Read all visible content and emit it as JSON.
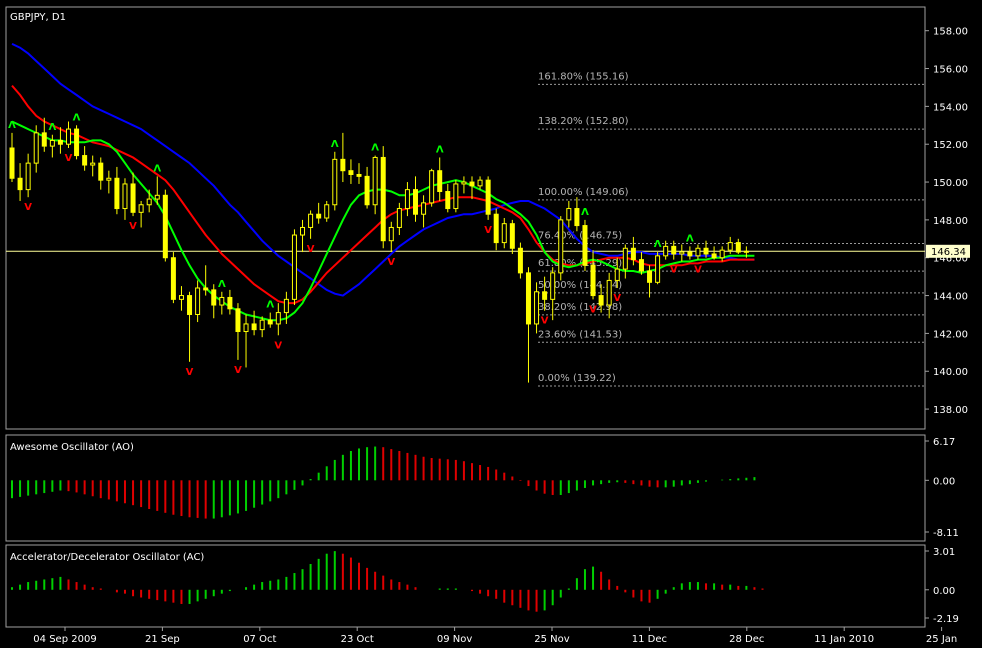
{
  "chart_data": {
    "type": "candlestick",
    "title": "GBPJPY, D1",
    "price_axis": {
      "ticks": [
        "158.00",
        "156.00",
        "154.00",
        "152.00",
        "150.00",
        "148.00",
        "146.00",
        "144.00",
        "142.00",
        "140.00",
        "138.00"
      ],
      "range": [
        137.0,
        159.2
      ]
    },
    "current_price": {
      "label": "146.34",
      "value": 146.34
    },
    "x_axis_labels": [
      "04 Sep 2009",
      "21 Sep",
      "07 Oct",
      "23 Oct",
      "09 Nov",
      "25 Nov",
      "11 Dec",
      "28 Dec",
      "11 Jan 2010",
      "25 Jan"
    ],
    "fibonacci": [
      {
        "label": "161.80% (155.16)",
        "value": 155.16
      },
      {
        "label": "138.20% (152.80)",
        "value": 152.8
      },
      {
        "label": "100.00% (149.06)",
        "value": 149.06
      },
      {
        "label": "76.40% (146.75)",
        "value": 146.75
      },
      {
        "label": "61.80% (145.29)",
        "value": 145.29
      },
      {
        "label": "50.00% (144.14)",
        "value": 144.14
      },
      {
        "label": "38.20% (142.98)",
        "value": 142.98
      },
      {
        "label": "23.60% (141.53)",
        "value": 141.53
      },
      {
        "label": "0.00% (139.22)",
        "value": 139.22
      }
    ],
    "candles": [
      [
        151.8,
        152.6,
        150.0,
        150.2
      ],
      [
        150.2,
        151.0,
        149.0,
        149.6
      ],
      [
        149.6,
        151.5,
        149.2,
        151.0
      ],
      [
        151.0,
        153.0,
        150.5,
        152.6
      ],
      [
        152.6,
        153.4,
        151.6,
        151.9
      ],
      [
        151.9,
        152.5,
        151.3,
        152.2
      ],
      [
        152.2,
        152.9,
        151.5,
        152.0
      ],
      [
        152.0,
        153.2,
        151.8,
        152.8
      ],
      [
        152.8,
        153.0,
        151.2,
        151.4
      ],
      [
        151.4,
        151.9,
        150.6,
        150.9
      ],
      [
        150.9,
        151.4,
        150.3,
        151.0
      ],
      [
        151.0,
        151.3,
        149.6,
        150.1
      ],
      [
        150.1,
        150.6,
        149.4,
        150.2
      ],
      [
        150.2,
        150.8,
        148.3,
        148.6
      ],
      [
        148.6,
        150.2,
        148.0,
        149.9
      ],
      [
        149.9,
        150.5,
        148.2,
        148.4
      ],
      [
        148.4,
        149.0,
        147.6,
        148.8
      ],
      [
        148.8,
        149.6,
        148.4,
        149.1
      ],
      [
        149.1,
        150.3,
        148.8,
        149.3
      ],
      [
        149.3,
        149.6,
        145.8,
        146.0
      ],
      [
        146.0,
        146.3,
        143.6,
        143.8
      ],
      [
        143.8,
        144.5,
        143.2,
        144.0
      ],
      [
        144.0,
        144.2,
        140.5,
        143.0
      ],
      [
        143.0,
        144.8,
        142.6,
        144.4
      ],
      [
        144.4,
        145.6,
        144.0,
        144.3
      ],
      [
        144.3,
        144.6,
        142.8,
        143.5
      ],
      [
        143.5,
        144.2,
        143.0,
        143.9
      ],
      [
        143.9,
        144.3,
        143.0,
        143.3
      ],
      [
        143.3,
        143.6,
        140.6,
        142.1
      ],
      [
        142.1,
        143.0,
        140.2,
        142.5
      ],
      [
        142.5,
        143.2,
        141.9,
        142.2
      ],
      [
        142.2,
        142.9,
        141.8,
        142.7
      ],
      [
        142.7,
        143.1,
        142.3,
        142.5
      ],
      [
        142.5,
        143.6,
        141.9,
        143.1
      ],
      [
        143.1,
        144.2,
        142.5,
        143.8
      ],
      [
        143.8,
        147.5,
        143.5,
        147.2
      ],
      [
        147.2,
        148.0,
        146.3,
        147.6
      ],
      [
        147.6,
        148.5,
        147.0,
        148.3
      ],
      [
        148.3,
        148.9,
        147.8,
        148.1
      ],
      [
        148.1,
        149.0,
        147.9,
        148.8
      ],
      [
        148.8,
        151.6,
        148.5,
        151.2
      ],
      [
        151.2,
        152.6,
        150.0,
        150.6
      ],
      [
        150.6,
        151.2,
        149.9,
        150.4
      ],
      [
        150.4,
        151.0,
        149.9,
        150.3
      ],
      [
        150.3,
        150.8,
        148.6,
        148.8
      ],
      [
        148.8,
        151.4,
        148.3,
        151.3
      ],
      [
        151.3,
        151.9,
        146.5,
        146.9
      ],
      [
        146.9,
        147.9,
        146.3,
        147.6
      ],
      [
        147.6,
        148.9,
        147.2,
        148.6
      ],
      [
        148.6,
        150.0,
        148.2,
        149.6
      ],
      [
        149.6,
        150.3,
        147.9,
        148.3
      ],
      [
        148.3,
        149.3,
        147.6,
        148.9
      ],
      [
        148.9,
        150.7,
        148.7,
        150.6
      ],
      [
        150.6,
        151.3,
        149.0,
        149.5
      ],
      [
        149.5,
        149.9,
        148.4,
        148.6
      ],
      [
        148.6,
        150.1,
        148.4,
        149.9
      ],
      [
        149.9,
        150.3,
        149.4,
        150.0
      ],
      [
        150.0,
        150.3,
        149.1,
        149.8
      ],
      [
        149.8,
        150.3,
        149.6,
        150.1
      ],
      [
        150.1,
        150.3,
        148.0,
        148.3
      ],
      [
        148.3,
        148.6,
        146.4,
        146.8
      ],
      [
        146.8,
        148.1,
        146.5,
        147.8
      ],
      [
        147.8,
        148.0,
        146.2,
        146.5
      ],
      [
        146.5,
        146.8,
        144.9,
        145.2
      ],
      [
        145.2,
        145.5,
        139.4,
        142.5
      ],
      [
        142.5,
        144.7,
        142.0,
        144.2
      ],
      [
        144.2,
        145.0,
        143.2,
        143.8
      ],
      [
        143.8,
        145.5,
        142.7,
        145.2
      ],
      [
        145.2,
        148.2,
        144.8,
        148.0
      ],
      [
        148.0,
        149.0,
        147.6,
        148.6
      ],
      [
        148.6,
        149.2,
        147.4,
        147.7
      ],
      [
        147.7,
        148.0,
        145.3,
        145.6
      ],
      [
        145.6,
        146.4,
        143.8,
        144.0
      ],
      [
        144.0,
        144.6,
        143.1,
        143.5
      ],
      [
        143.5,
        145.2,
        142.8,
        144.8
      ],
      [
        144.8,
        146.0,
        144.4,
        145.4
      ],
      [
        145.4,
        146.7,
        144.9,
        146.5
      ],
      [
        146.5,
        147.1,
        145.6,
        145.9
      ],
      [
        145.9,
        146.3,
        145.1,
        145.3
      ],
      [
        145.3,
        145.6,
        143.9,
        144.7
      ],
      [
        144.7,
        146.3,
        144.6,
        146.1
      ],
      [
        146.1,
        146.9,
        145.9,
        146.6
      ],
      [
        146.6,
        146.9,
        145.9,
        146.2
      ],
      [
        146.2,
        146.7,
        145.8,
        146.3
      ],
      [
        146.3,
        146.6,
        145.9,
        146.1
      ],
      [
        146.1,
        146.7,
        145.9,
        146.5
      ],
      [
        146.5,
        146.9,
        146.0,
        146.2
      ],
      [
        146.2,
        146.6,
        145.9,
        146.0
      ],
      [
        146.0,
        146.6,
        145.8,
        146.4
      ],
      [
        146.4,
        147.1,
        146.2,
        146.8
      ],
      [
        146.8,
        147.0,
        146.2,
        146.3
      ],
      [
        146.3,
        146.6,
        146.0,
        146.34
      ]
    ],
    "ma_blue": [
      157.3,
      157.1,
      156.8,
      156.4,
      156.0,
      155.6,
      155.2,
      154.9,
      154.6,
      154.3,
      154.0,
      153.8,
      153.6,
      153.4,
      153.2,
      153.0,
      152.8,
      152.5,
      152.2,
      151.9,
      151.6,
      151.3,
      151.0,
      150.6,
      150.2,
      149.8,
      149.3,
      148.8,
      148.4,
      147.9,
      147.4,
      146.9,
      146.5,
      146.1,
      145.8,
      145.5,
      145.2,
      144.9,
      144.6,
      144.3,
      144.1,
      144.0,
      144.3,
      144.6,
      145.0,
      145.4,
      145.8,
      146.2,
      146.6,
      146.9,
      147.2,
      147.5,
      147.7,
      147.9,
      148.1,
      148.2,
      148.3,
      148.3,
      148.4,
      148.5,
      148.6,
      148.8,
      148.9,
      149.0,
      149.0,
      148.8,
      148.6,
      148.3,
      148.0,
      147.5,
      147.0,
      146.6,
      146.3,
      146.2,
      146.1,
      146.1,
      146.2,
      146.3,
      146.3,
      146.2,
      146.2,
      146.2,
      146.2,
      146.2,
      146.1,
      146.1,
      146.1,
      146.1,
      146.0,
      146.0,
      145.9,
      145.9,
      145.9
    ],
    "ma_red": [
      155.1,
      154.6,
      154.0,
      153.5,
      153.2,
      153.0,
      152.8,
      152.6,
      152.5,
      152.3,
      152.1,
      152.0,
      151.9,
      151.7,
      151.5,
      151.3,
      151.0,
      150.7,
      150.4,
      150.1,
      149.6,
      149.0,
      148.4,
      147.8,
      147.2,
      146.7,
      146.2,
      145.8,
      145.4,
      145.0,
      144.6,
      144.3,
      144.0,
      143.7,
      143.6,
      143.6,
      143.8,
      144.2,
      144.7,
      145.2,
      145.6,
      146.0,
      146.4,
      146.8,
      147.2,
      147.6,
      148.0,
      148.3,
      148.5,
      148.6,
      148.7,
      148.8,
      148.9,
      149.0,
      149.1,
      149.2,
      149.2,
      149.2,
      149.1,
      149.0,
      148.8,
      148.6,
      148.4,
      148.1,
      147.5,
      146.8,
      146.3,
      145.9,
      145.7,
      145.6,
      145.6,
      145.7,
      145.8,
      145.9,
      146.0,
      146.0,
      146.0,
      145.9,
      145.7,
      145.6,
      145.6,
      145.6,
      145.6,
      145.6,
      145.7,
      145.7,
      145.8,
      145.8,
      145.8,
      145.9,
      145.9,
      145.9,
      145.9
    ],
    "ma_green": [
      153.2,
      153.0,
      152.8,
      152.6,
      152.4,
      152.2,
      152.2,
      152.1,
      152.1,
      152.1,
      152.2,
      152.2,
      152.0,
      151.6,
      151.0,
      150.4,
      149.9,
      149.4,
      148.9,
      148.2,
      147.3,
      146.4,
      145.6,
      144.9,
      144.4,
      144.0,
      143.7,
      143.4,
      143.2,
      143.0,
      142.9,
      142.8,
      142.7,
      142.7,
      142.8,
      143.1,
      143.6,
      144.4,
      145.3,
      146.2,
      147.1,
      148.0,
      148.8,
      149.3,
      149.5,
      149.6,
      149.6,
      149.5,
      149.3,
      149.3,
      149.4,
      149.6,
      149.8,
      149.9,
      150.0,
      150.1,
      150.0,
      149.8,
      149.6,
      149.4,
      149.1,
      148.9,
      148.6,
      148.3,
      147.9,
      147.2,
      146.3,
      145.8,
      145.6,
      145.5,
      145.6,
      145.8,
      145.9,
      145.8,
      145.6,
      145.4,
      145.3,
      145.3,
      145.2,
      145.3,
      145.4,
      145.6,
      145.7,
      145.8,
      145.8,
      145.9,
      145.9,
      146.0,
      146.0,
      146.1,
      146.1,
      146.1,
      146.1
    ],
    "fractals_up": [
      0,
      5,
      8,
      18,
      26,
      32,
      40,
      45,
      53,
      71,
      80,
      84
    ],
    "fractals_down": [
      2,
      7,
      15,
      22,
      28,
      33,
      37,
      47,
      59,
      66,
      72,
      75,
      82,
      85
    ],
    "ao": {
      "title": "Awesome Oscillator (AO)",
      "ticks": [
        "6.17",
        "0.00",
        "-8.11"
      ],
      "range": [
        -8.11,
        6.17
      ],
      "values": [
        -2.8,
        -2.6,
        -2.4,
        -2.2,
        -2.0,
        -1.8,
        -1.6,
        -1.7,
        -1.9,
        -2.2,
        -2.5,
        -2.8,
        -3.0,
        -3.3,
        -3.6,
        -3.9,
        -4.2,
        -4.5,
        -4.8,
        -5.1,
        -5.4,
        -5.6,
        -5.8,
        -5.9,
        -6.0,
        -6.0,
        -5.8,
        -5.5,
        -5.2,
        -4.8,
        -4.3,
        -3.8,
        -3.3,
        -2.8,
        -2.2,
        -1.5,
        -0.8,
        0.2,
        1.2,
        2.2,
        3.2,
        4.0,
        4.6,
        5.0,
        5.2,
        5.3,
        5.2,
        4.9,
        4.6,
        4.3,
        4.0,
        3.7,
        3.5,
        3.4,
        3.3,
        3.2,
        3.0,
        2.7,
        2.4,
        2.1,
        1.7,
        1.2,
        0.6,
        -0.1,
        -0.9,
        -1.6,
        -2.1,
        -2.3,
        -2.3,
        -2.0,
        -1.6,
        -1.2,
        -0.8,
        -0.6,
        -0.4,
        -0.3,
        -0.4,
        -0.6,
        -0.8,
        -1.0,
        -1.1,
        -1.1,
        -1.0,
        -0.8,
        -0.6,
        -0.4,
        -0.2,
        0.0,
        0.1,
        0.2,
        0.3,
        0.4,
        0.5
      ]
    },
    "ac": {
      "title": "Accelerator/Decelerator Oscillator (AC)",
      "ticks": [
        "3.01",
        "0.00",
        "-2.19"
      ],
      "range": [
        -2.19,
        3.01
      ],
      "values": [
        0.2,
        0.4,
        0.6,
        0.7,
        0.8,
        0.9,
        1.0,
        0.8,
        0.6,
        0.4,
        0.2,
        0.1,
        0.0,
        -0.2,
        -0.3,
        -0.5,
        -0.6,
        -0.7,
        -0.8,
        -0.9,
        -1.0,
        -1.1,
        -1.1,
        -0.9,
        -0.7,
        -0.5,
        -0.3,
        -0.1,
        0.0,
        0.2,
        0.4,
        0.6,
        0.7,
        0.8,
        1.0,
        1.3,
        1.6,
        2.0,
        2.4,
        2.8,
        3.0,
        2.8,
        2.5,
        2.1,
        1.7,
        1.4,
        1.1,
        0.8,
        0.6,
        0.4,
        0.2,
        0.0,
        0.0,
        0.1,
        0.1,
        0.1,
        0.0,
        -0.1,
        -0.3,
        -0.5,
        -0.7,
        -1.0,
        -1.2,
        -1.4,
        -1.6,
        -1.7,
        -1.6,
        -1.2,
        -0.6,
        0.1,
        0.9,
        1.6,
        1.8,
        1.4,
        0.8,
        0.3,
        -0.2,
        -0.6,
        -0.9,
        -1.0,
        -0.7,
        -0.3,
        0.2,
        0.5,
        0.6,
        0.6,
        0.5,
        0.5,
        0.4,
        0.4,
        0.3,
        0.3,
        0.2,
        0.1
      ]
    }
  }
}
